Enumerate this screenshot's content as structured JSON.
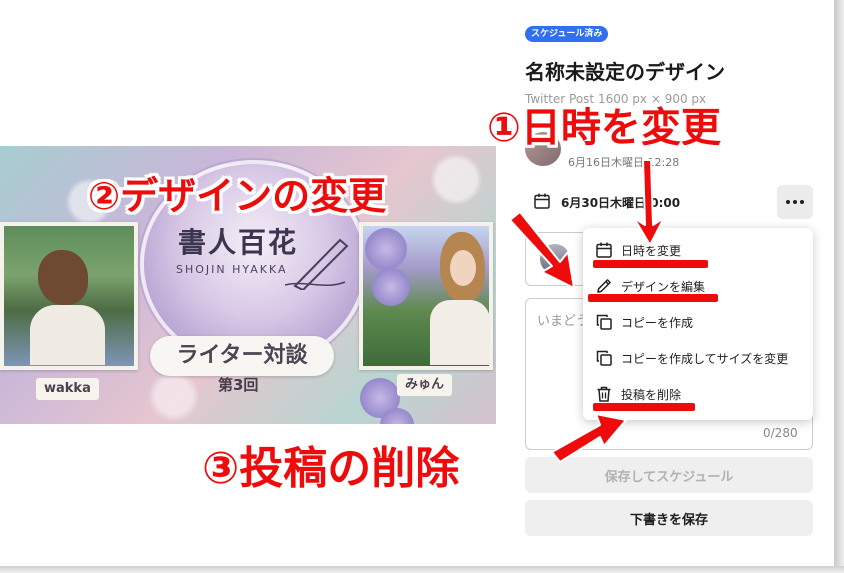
{
  "status_badge": "スケジュール済み",
  "design": {
    "title": "名称未設定のデザイン",
    "size": "Twitter Post 1600 px × 900 px",
    "owner_date": "6月16日木曜日 12:28",
    "scheduled": "6月30日木曜日 0:00"
  },
  "preview": {
    "title": "書人百花",
    "subtitle": "SHOJIN HYAKKA",
    "banner": "ライター対談",
    "episode": "第3回",
    "left_name": "wakka",
    "right_name": "みゅん"
  },
  "post": {
    "placeholder": "いまどうしてる？",
    "counter": "0/280"
  },
  "buttons": {
    "schedule": "保存してスケジュール",
    "draft": "下書きを保存"
  },
  "menu": [
    {
      "label": "日時を変更",
      "icon": "calendar-icon"
    },
    {
      "label": "デザインを編集",
      "icon": "pencil-icon"
    },
    {
      "label": "コピーを作成",
      "icon": "copy-icon"
    },
    {
      "label": "コピーを作成してサイズを変更",
      "icon": "copy-resize-icon"
    },
    {
      "label": "投稿を削除",
      "icon": "trash-icon"
    }
  ],
  "annotations": {
    "a1": "①日時を変更",
    "a2": "②デザインの変更",
    "a3": "③投稿の削除"
  },
  "colors": {
    "accent": "#2f6ff0",
    "annotation": "#ee0b0b"
  }
}
